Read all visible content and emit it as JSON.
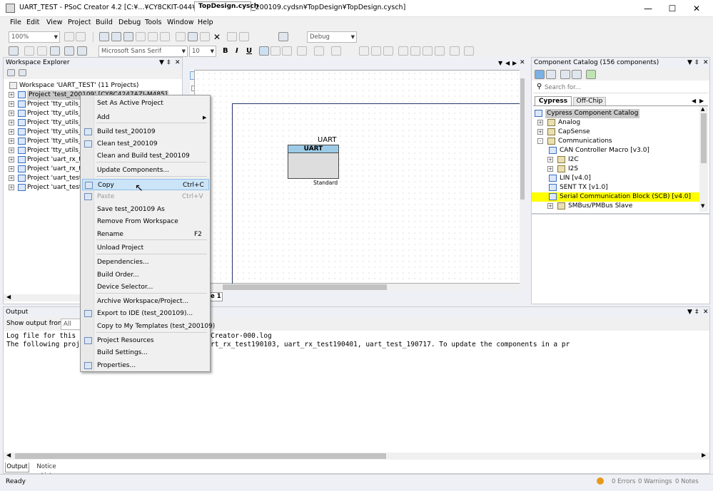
{
  "window": {
    "title": "UART_TEST - PSoC Creator 4.2  [C:¥...¥CY8CKIT-044¥UART_TEST¥test_200109.cydsn¥TopDesign¥TopDesign.cysch]"
  },
  "menu": [
    "File",
    "Edit",
    "View",
    "Project",
    "Build",
    "Debug",
    "Tools",
    "Window",
    "Help"
  ],
  "toolbar": {
    "zoom": "100%",
    "config": "Debug",
    "font": "Microsoft Sans Serif",
    "font_size": "10",
    "bold": "B",
    "italic": "I",
    "underline": "U"
  },
  "workspace_explorer": {
    "title": "Workspace Explorer",
    "root": "Workspace 'UART_TEST' (11 Projects)",
    "projects": [
      "Project 'test_200109' [CY8C4247AZI-M485]",
      "Project 'tty_utils_te",
      "Project 'tty_utils_te",
      "Project 'tty_utils_te",
      "Project 'tty_utils_te",
      "Project 'tty_utils_te",
      "Project 'tty_utils_te",
      "Project 'uart_rx_tes",
      "Project 'uart_rx_tes",
      "Project 'uart_test_1",
      "Project 'uart_test_1"
    ]
  },
  "design": {
    "tab": "TopDesign.cysch",
    "page_tab": "e 1",
    "component_name": "UART",
    "component_title": "UART",
    "component_mode": "Standard"
  },
  "catalog": {
    "title": "Component Catalog (156 components)",
    "search_placeholder": "Search for...",
    "tabs": [
      "Cypress",
      "Off-Chip"
    ],
    "items": [
      "Cypress Component Catalog",
      "Analog",
      "CapSense",
      "Communications",
      "CAN Controller Macro [v3.0]",
      "I2C",
      "I2S",
      "LIN [v4.0]",
      "SENT TX [v1.0]",
      "Serial Communication Block (SCB) [v4.0]",
      "SMBus/PMBus Slave"
    ]
  },
  "output": {
    "title": "Output",
    "show_label": "Show output from:",
    "show_value": "All",
    "lines": [
      "Log file for this                   \\700650\\AppData\\Local\\Temp\\PSoC Creator-000.log",
      "The following proj                   available: uart_test_181221, uart_rx_test190103, uart_rx_test190401, uart_test_190717. To update the components in a pr"
    ],
    "tabs": [
      "Output",
      "Notice List"
    ]
  },
  "status": {
    "text": "Ready",
    "errors": "0 Errors",
    "warnings": "0 Warnings",
    "notes": "0 Notes"
  },
  "context_menu": {
    "items": [
      {
        "label": "Set As Active Project"
      },
      {
        "label": "Add",
        "submenu": true
      },
      {
        "label": "Build test_200109"
      },
      {
        "label": "Clean test_200109"
      },
      {
        "label": "Clean and Build test_200109"
      },
      {
        "label": "Update Components..."
      },
      {
        "label": "Copy",
        "shortcut": "Ctrl+C"
      },
      {
        "label": "Paste",
        "shortcut": "Ctrl+V"
      },
      {
        "label": "Save test_200109 As"
      },
      {
        "label": "Remove From Workspace"
      },
      {
        "label": "Rename",
        "shortcut": "F2"
      },
      {
        "label": "Unload Project"
      },
      {
        "label": "Dependencies..."
      },
      {
        "label": "Build Order..."
      },
      {
        "label": "Device Selector..."
      },
      {
        "label": "Archive Workspace/Project..."
      },
      {
        "label": "Export to IDE (test_200109)..."
      },
      {
        "label": "Copy to My Templates (test_200109)"
      },
      {
        "label": "Project Resources"
      },
      {
        "label": "Build Settings..."
      },
      {
        "label": "Properties..."
      }
    ]
  },
  "colors": {
    "highlight": "#ffff00",
    "selection": "#cce4f7",
    "component_header": "#9ccbe7"
  }
}
